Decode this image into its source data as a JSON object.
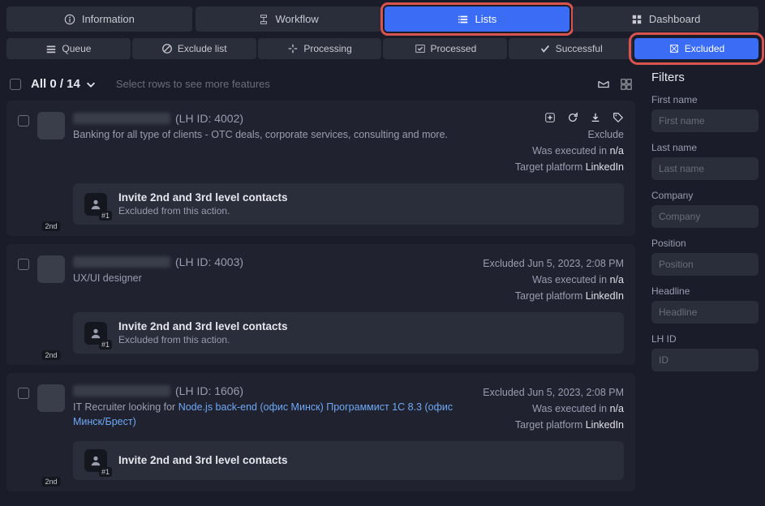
{
  "topTabs": [
    {
      "label": "Information",
      "icon": "info"
    },
    {
      "label": "Workflow",
      "icon": "workflow"
    },
    {
      "label": "Lists",
      "icon": "lists",
      "active": true,
      "highlighted": true
    },
    {
      "label": "Dashboard",
      "icon": "dashboard"
    }
  ],
  "subTabs": [
    {
      "label": "Queue",
      "icon": "queue"
    },
    {
      "label": "Exclude list",
      "icon": "exclude"
    },
    {
      "label": "Processing",
      "icon": "processing"
    },
    {
      "label": "Processed",
      "icon": "processed"
    },
    {
      "label": "Successful",
      "icon": "successful"
    },
    {
      "label": "Excluded",
      "icon": "excluded",
      "active": true,
      "highlighted": true
    }
  ],
  "header": {
    "countLabel": "All 0 / 14",
    "hint": "Select rows to see more features"
  },
  "cards": [
    {
      "lhId": "(LH ID: 4002)",
      "degree": "2nd",
      "desc": "Banking for all type of clients - OTC deals, corporate services, consulting and more.",
      "excluded": "Exclude",
      "executedLabel": "Was executed in",
      "executedVal": "n/a",
      "platformLabel": "Target platform",
      "platformVal": "LinkedIn",
      "showIcons": true,
      "action": {
        "title": "Invite 2nd and 3rd level contacts",
        "sub": "Excluded from this action.",
        "badge": "#1"
      }
    },
    {
      "lhId": "(LH ID: 4003)",
      "degree": "2nd",
      "desc": "UX/UI designer",
      "excluded": "Excluded Jun 5, 2023, 2:08 PM",
      "executedLabel": "Was executed in",
      "executedVal": "n/a",
      "platformLabel": "Target platform",
      "platformVal": "LinkedIn",
      "showIcons": false,
      "action": {
        "title": "Invite 2nd and 3rd level contacts",
        "sub": "Excluded from this action.",
        "badge": "#1"
      }
    },
    {
      "lhId": "(LH ID: 1606)",
      "degree": "2nd",
      "descParts": [
        "IT Recruiter looking for",
        " Node.js back-end (офис Минск)",
        "  Программист 1С 8.3 (офис Минск/Брест)"
      ],
      "excluded": "Excluded Jun 5, 2023, 2:08 PM",
      "executedLabel": "Was executed in",
      "executedVal": "n/a",
      "platformLabel": "Target platform",
      "platformVal": "LinkedIn",
      "showIcons": false,
      "action": {
        "title": "Invite 2nd and 3rd level contacts",
        "sub": "",
        "badge": "#1"
      }
    }
  ],
  "filters": {
    "title": "Filters",
    "fields": [
      {
        "label": "First name",
        "placeholder": "First name"
      },
      {
        "label": "Last name",
        "placeholder": "Last name"
      },
      {
        "label": "Company",
        "placeholder": "Company"
      },
      {
        "label": "Position",
        "placeholder": "Position"
      },
      {
        "label": "Headline",
        "placeholder": "Headline"
      },
      {
        "label": "LH ID",
        "placeholder": "ID"
      }
    ]
  }
}
